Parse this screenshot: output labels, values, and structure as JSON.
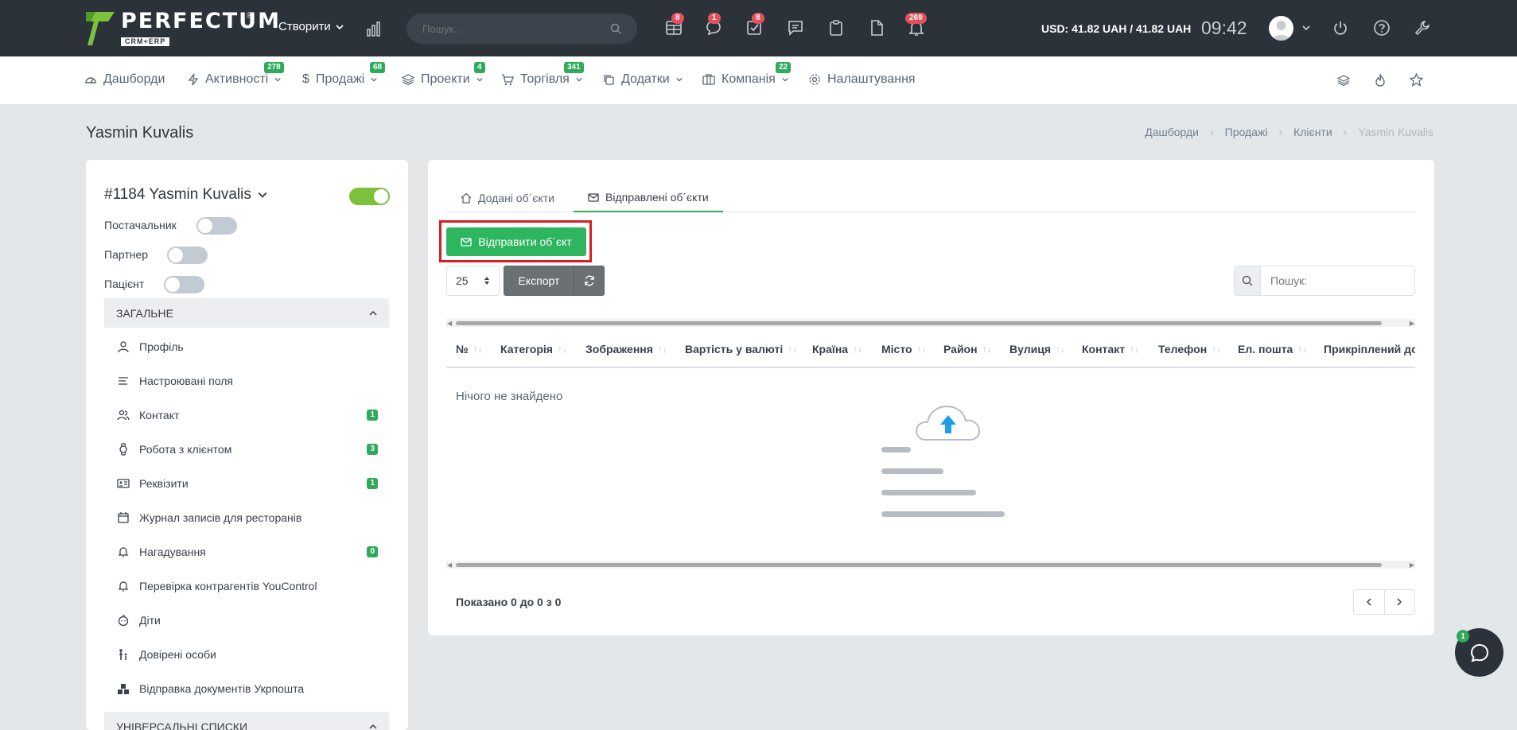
{
  "topbar": {
    "logo_text": "PERFECTUM",
    "logo_sub": "CRM+ERP",
    "logo_reg": "®",
    "create_label": "Створити",
    "search_placeholder": "Пошук...",
    "badges": {
      "table": "8",
      "chat": "1",
      "tasks": "8",
      "bell": "269"
    },
    "currency": "USD: 41.82 UAH / 41.82 UAH",
    "time": "09:42"
  },
  "menu": {
    "items": [
      {
        "label": "Дашборди",
        "badge": ""
      },
      {
        "label": "Активності",
        "badge": "278"
      },
      {
        "label": "Продажі",
        "badge": "68"
      },
      {
        "label": "Проекти",
        "badge": "4"
      },
      {
        "label": "Торгівля",
        "badge": "341"
      },
      {
        "label": "Додатки",
        "badge": ""
      },
      {
        "label": "Компанія",
        "badge": "22"
      },
      {
        "label": "Налаштування",
        "badge": ""
      }
    ]
  },
  "page": {
    "title": "Yasmin Kuvalis",
    "breadcrumb": [
      "Дашборди",
      "Продажі",
      "Клієнти",
      "Yasmin Kuvalis"
    ]
  },
  "left": {
    "client_name": "#1184 Yasmin Kuvalis",
    "flags": [
      "Постачальник",
      "Партнер",
      "Пацієнт"
    ],
    "section_general": "ЗАГАЛЬНЕ",
    "items": [
      {
        "label": "Профіль",
        "count": ""
      },
      {
        "label": "Настроювані поля",
        "count": ""
      },
      {
        "label": "Контакт",
        "count": "1"
      },
      {
        "label": "Робота з клієнтом",
        "count": "3"
      },
      {
        "label": "Реквізити",
        "count": "1"
      },
      {
        "label": "Журнал записів для ресторанів",
        "count": ""
      },
      {
        "label": "Нагадування",
        "count": "0"
      },
      {
        "label": "Перевірка контрагентів YouControl",
        "count": ""
      },
      {
        "label": "Діти",
        "count": ""
      },
      {
        "label": "Довірені особи",
        "count": ""
      },
      {
        "label": "Відправка документів Укрпошта",
        "count": ""
      }
    ],
    "section_universal": "УНІВЕРСАЛЬНІ СПИСКИ"
  },
  "main": {
    "tabs": [
      "Додані об´єкти",
      "Відправлені об´єкти"
    ],
    "send_button": "Відправити об´єкт",
    "page_size": "25",
    "export_label": "Експорт",
    "search_placeholder": "Пошук:",
    "columns": [
      "№",
      "Категорія",
      "Зображення",
      "Вартість у валюті",
      "Країна",
      "Місто",
      "Район",
      "Вулиця",
      "Контакт",
      "Телефон",
      "Ел. пошта",
      "Прикріплений до"
    ],
    "empty_text": "Нічого не знайдено",
    "info": "Показано 0 до 0 з 0"
  },
  "chat": {
    "badge": "1"
  },
  "colors": {
    "topbar": "#2b323a",
    "accent_green": "#2db65f",
    "highlight_red": "#d81e22",
    "badge_red": "#e5505a"
  }
}
